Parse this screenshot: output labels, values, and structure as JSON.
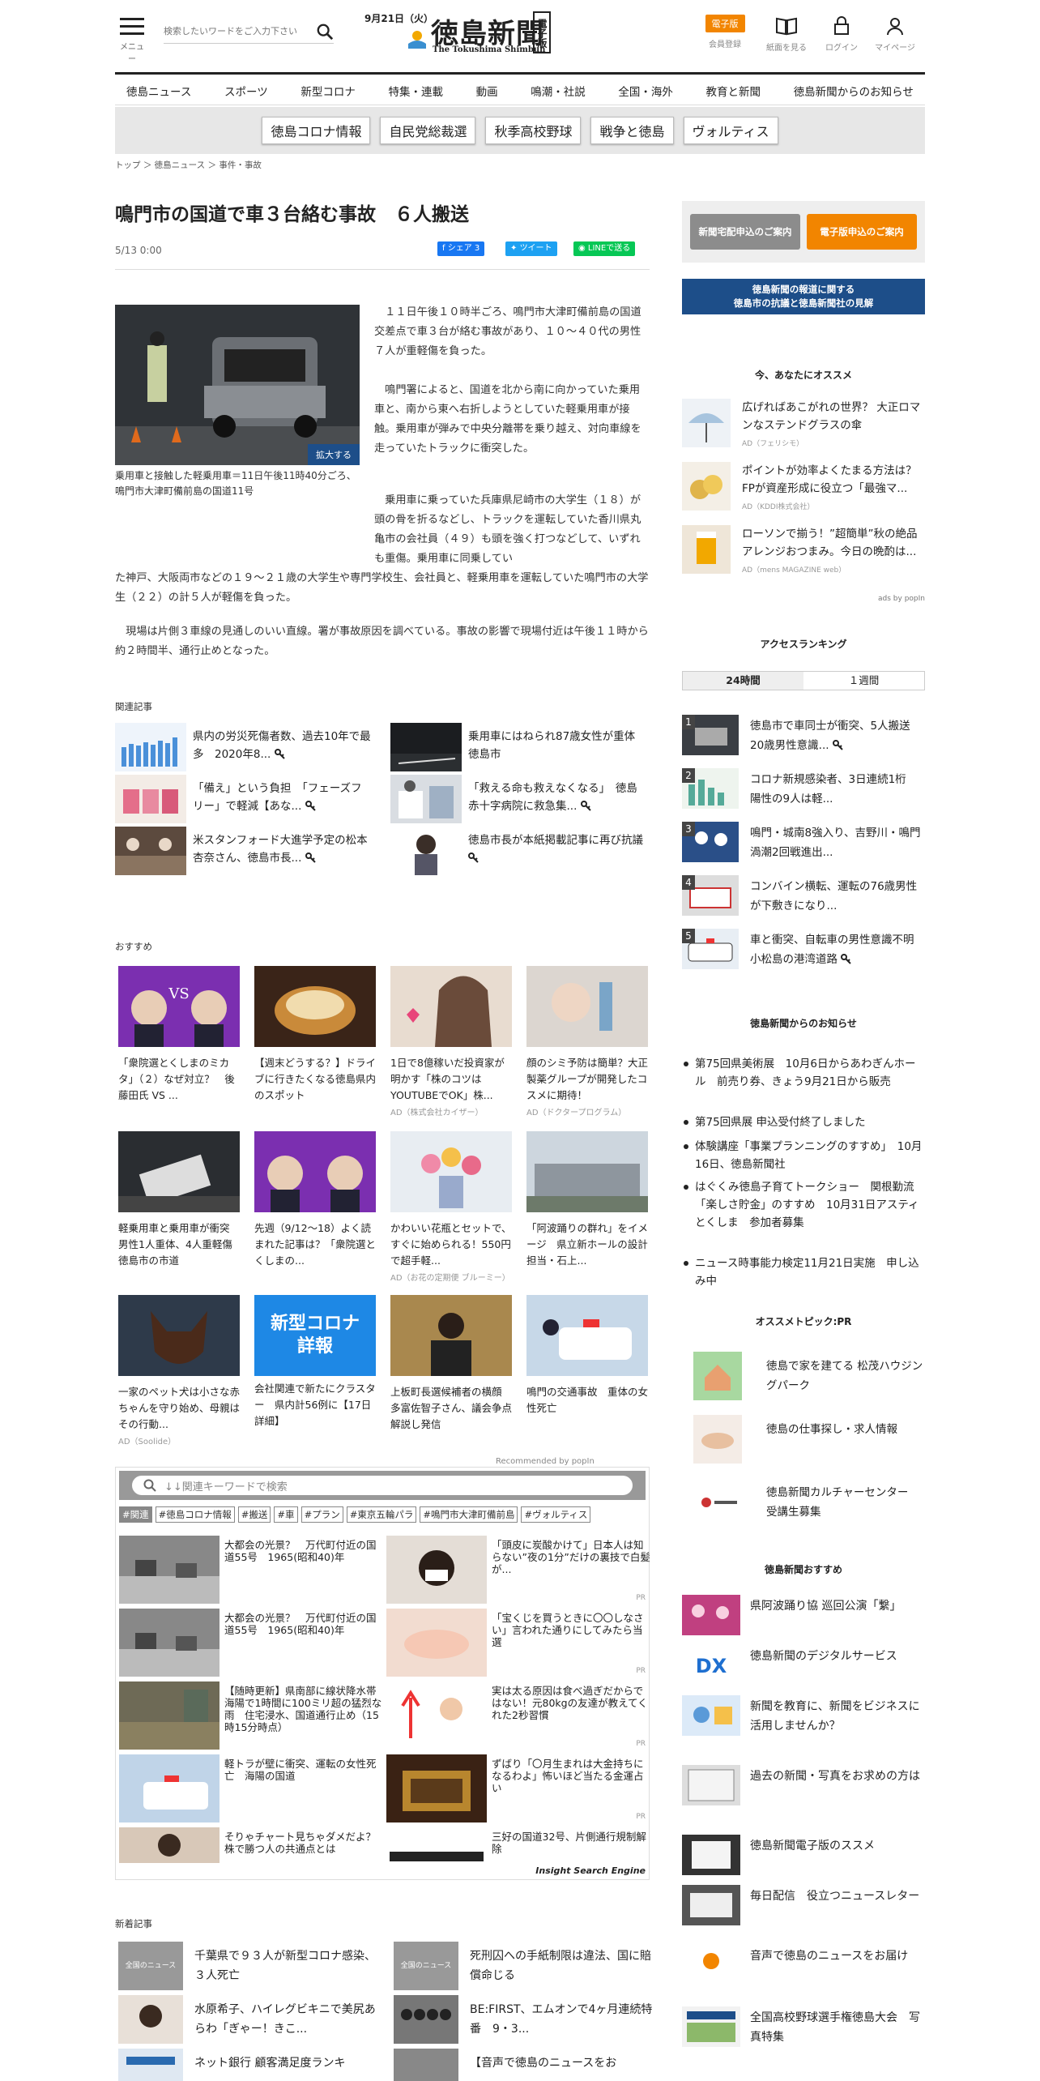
{
  "header": {
    "menu_label": "メニュー",
    "search_placeholder": "検索したいワードをご入力下さい",
    "date": "9月21日（火）",
    "logo_text": "徳島新聞",
    "logo_en": "The Tokushima Shimbun",
    "logo_badge": "電子版",
    "denshi_button": "電子版",
    "member_label": "会員登録",
    "paper_label": "紙面を見る",
    "login_label": "ログイン",
    "mypage_label": "マイページ"
  },
  "nav": [
    "徳島ニュース",
    "スポーツ",
    "新型コロナ",
    "特集・連載",
    "動画",
    "鳴潮・社説",
    "全国・海外",
    "教育と新聞",
    "徳島新聞からのお知らせ"
  ],
  "pills": [
    "徳島コロナ情報",
    "自民党総裁選",
    "秋季高校野球",
    "戦争と徳島",
    "ヴォルティス"
  ],
  "breadcrumb": "トップ ＞ 徳島ニュース ＞ 事件・事故",
  "article": {
    "title": "鳴門市の国道で車３台絡む事故　６人搬送",
    "date": "5/13 0:00",
    "share_fb": "シェア 3",
    "share_tw": "ツイート",
    "share_line": "LINEで送る",
    "enlarge": "拡大する",
    "caption": "乗用車と接触した軽乗用車＝11日午後11時40分ごろ、鳴門市大津町備前島の国道11号",
    "p1": "　１１日午後１０時半ごろ、鳴門市大津町備前島の国道交差点で車３台が絡む事故があり、１０～４０代の男性７人が重軽傷を負った。",
    "p2": "　鳴門署によると、国道を北から南に向かっていた乗用車と、南から東へ右折しようとしていた軽乗用車が接触。乗用車が弾みで中央分離帯を乗り越え、対向車線を走っていたトラックに衝突した。",
    "p3a": "　乗用車に乗っていた兵庫県尼崎市の大学生（１８）が頭の骨を折るなどし、トラックを運転していた香川県丸亀市の会社員（４９）も頭を強く打つなどして、いずれも重傷。乗用車に同乗してい",
    "p3b": "た神戸、大阪両市などの１９～２１歳の大学生や専門学校生、会社員と、軽乗用車を運転していた鳴門市の大学生（２２）の計５人が軽傷を負った。",
    "p4": "　現場は片側３車線の見通しのいい直線。署が事故原因を調べている。事故の影響で現場付近は午後１１時から約２時間半、通行止めとなった。"
  },
  "related": {
    "heading": "関連記事",
    "items": [
      "県内の労災死傷者数、過去10年で最多　2020年8...",
      "乗用車にはねられ87歳女性が重体　徳島市",
      "「備え」という負担　「フェーズフリー」で軽減【あな...",
      "「救える命も救えなくなる」　徳島赤十字病院に救急集...",
      "米スタンフォード大進学予定の松本杏奈さん、徳島市長...",
      "徳島市長が本紙掲載記事に再び抗議"
    ]
  },
  "osusume": {
    "heading": "おすすめ",
    "cards": [
      {
        "t": "「衆院選とくしまのミカタ」（２）なぜ対立？　後藤田氏 VS ...",
        "ad": ""
      },
      {
        "t": "【週末どうする？】ドライブに行きたくなる徳島県内のスポット",
        "ad": ""
      },
      {
        "t": "1日で8億稼いだ投資家が明かす「株のコツはYOUTUBEでOK」株...",
        "ad": "AD（株式会社カイザー）"
      },
      {
        "t": "顔のシミ予防は簡単？大正製薬グループが開発したコスメに期待！",
        "ad": "AD（ドクタープログラム）"
      },
      {
        "t": "軽乗用車と乗用車が衝突　男性1人重体、4人重軽傷　徳島市の市道",
        "ad": ""
      },
      {
        "t": "先週（9/12～18）よく読まれた記事は？「衆院選とくしまの...",
        "ad": ""
      },
      {
        "t": "かわいい花瓶とセットで、すぐに始められる！550円で超手軽...",
        "ad": "AD（お花の定期便 ブルーミー）"
      },
      {
        "t": "「阿波踊りの群れ」をイメージ　県立新ホールの設計担当・石上...",
        "ad": ""
      },
      {
        "t": "一家のペット犬は小さな赤ちゃんを守り始め、母親はその行動...",
        "ad": "AD（Soolide）"
      },
      {
        "t": "会社関連で新たにクラスター　県内計56例に【17日詳細】",
        "ad": ""
      },
      {
        "t": "上板町長選候補者の横顔　多富佐智子さん、議会争点解説し発信",
        "ad": ""
      },
      {
        "t": "鳴門の交通事故　重体の女性死亡",
        "ad": ""
      }
    ],
    "covid_title": "新型コロナ\n詳報",
    "recommended_by": "Recommended by popIn"
  },
  "insight": {
    "placeholder": "↓↓関連キーワードで検索",
    "tags": [
      "#関連",
      "#徳島コロナ情報",
      "#搬送",
      "#車",
      "#プラン",
      "#東京五輪パラ",
      "#鳴門市大津町備前島",
      "#ヴォルティス"
    ],
    "items": [
      "大都会の光景？　万代町付近の国道55号　1965(昭和40)年",
      "「頭皮に炭酸かけて」日本人は知らない”夜の1分”だけの裏技で白髪が...",
      "大都会の光景？　万代町付近の国道55号　1965(昭和40)年",
      "「宝くじを買うときに〇〇しなさい」言われた通りにしてみたら当選",
      "【随時更新】県南部に線状降水帯　海陽で1時間に100ミリ超の猛烈な雨　住宅浸水、国道通行止め（15時15分時点）",
      "実は太る原因は食べ過ぎだからではない！元80kgの友達が教えてくれた2秒習慣",
      "軽トラが壁に衝突、運転の女性死亡　海陽の国道",
      "ずばり「〇月生まれは大金持ちになるわよ」怖いほど当たる金運占い",
      "そりゃチャート見ちゃダメだよ？株で勝つ人の共通点とは",
      "三好の国道32号、片側通行規制解除"
    ],
    "pr": "PR",
    "brand": "Insight Search Engine"
  },
  "new_articles": {
    "heading": "新着記事",
    "items": [
      "千葉県で９３人が新型コロナ感染、３人死亡",
      "死刑囚への手紙制限は違法、国に賠償命じる",
      "水原希子、ハイレグビキニで美尻あらわ「ぎゃー！きこ...",
      "BE:FIRST、エムオンで4ヶ月連続特番　9・3...",
      "ネット銀行 顧客満足度ランキ",
      "【音声で徳島のニュースをお"
    ],
    "zenkoku_label": "全国のニュース"
  },
  "sidebar": {
    "btn_takuhai": "新聞宅配申込のご案内",
    "btn_denshi": "電子版申込のご案内",
    "banner": "徳島新聞の報道に関する\n徳島市の抗議と徳島新聞社の見解",
    "ima_heading": "今、あなたにオススメ",
    "ima_items": [
      {
        "t": "広げればあこがれの世界？ 大正ロマンなステンドグラスの傘",
        "ad": "AD（フェリシモ）"
      },
      {
        "t": "ポイントが効率よくたまる方法は？FPが資産形成に役立つ「最強マ...",
        "ad": "AD（KDDI株式会社）"
      },
      {
        "t": "ローソンで揃う！”超簡単”秋の絶品アレンジおつまみ。今日の晩酌は...",
        "ad": "AD（mens MAGAZINE web）"
      }
    ],
    "ads_by": "ads by popIn",
    "ranking_heading": "アクセスランキング",
    "tab_24h": "24時間",
    "tab_week": "１週間",
    "ranking": [
      "徳島市で車同士が衝突、5人搬送　20歳男性意識...",
      "コロナ新規感染者、3日連続1桁　陽性の9人は軽...",
      "鳴門・城南8強入り、吉野川・鳴門渦潮2回戦進出...",
      "コンバイン横転、運転の76歳男性が下敷きになり...",
      "車と衝突、自転車の男性意識不明　小松島の港湾道路"
    ],
    "oshirase_heading": "徳島新聞からのお知らせ",
    "oshirase": [
      "第75回県美術展　10月6日からあわぎんホール　前売り券、きょう9月21日から販売",
      "第75回県展 申込受付終了しました",
      "体験講座「事業プランニングのすすめ」　10月16日、徳島新聞社",
      "はぐくみ徳島子育てトークショー　関根勤流「楽しさ貯金」のすすめ　10月31日アスティとくしま　参加者募集",
      "ニュース時事能力検定11月21日実施　申し込み中"
    ],
    "topic_heading": "オススメトピック:PR",
    "topics": [
      "徳島で家を建てる 松茂ハウジングパーク",
      "徳島の仕事探し・求人情報",
      "徳島新聞カルチャーセンター　受講生募集"
    ],
    "sho_heading": "徳島新聞おすすめ",
    "sho_items": [
      "県阿波踊り協 巡回公演「繋」",
      "徳島新聞のデジタルサービス",
      "新聞を教育に、新聞をビジネスに活用しませんか？",
      "過去の新聞・写真をお求めの方は",
      "徳島新聞電子版のススメ",
      "毎日配信　役立つニュースレター",
      "音声で徳島のニュースをお届け",
      "全国高校野球選手権徳島大会　写真特集"
    ]
  },
  "colors": {
    "accent_orange": "#f28500",
    "navy": "#1d4e89",
    "fb": "#1877f2",
    "tw": "#1da1f2",
    "line": "#06c755"
  }
}
